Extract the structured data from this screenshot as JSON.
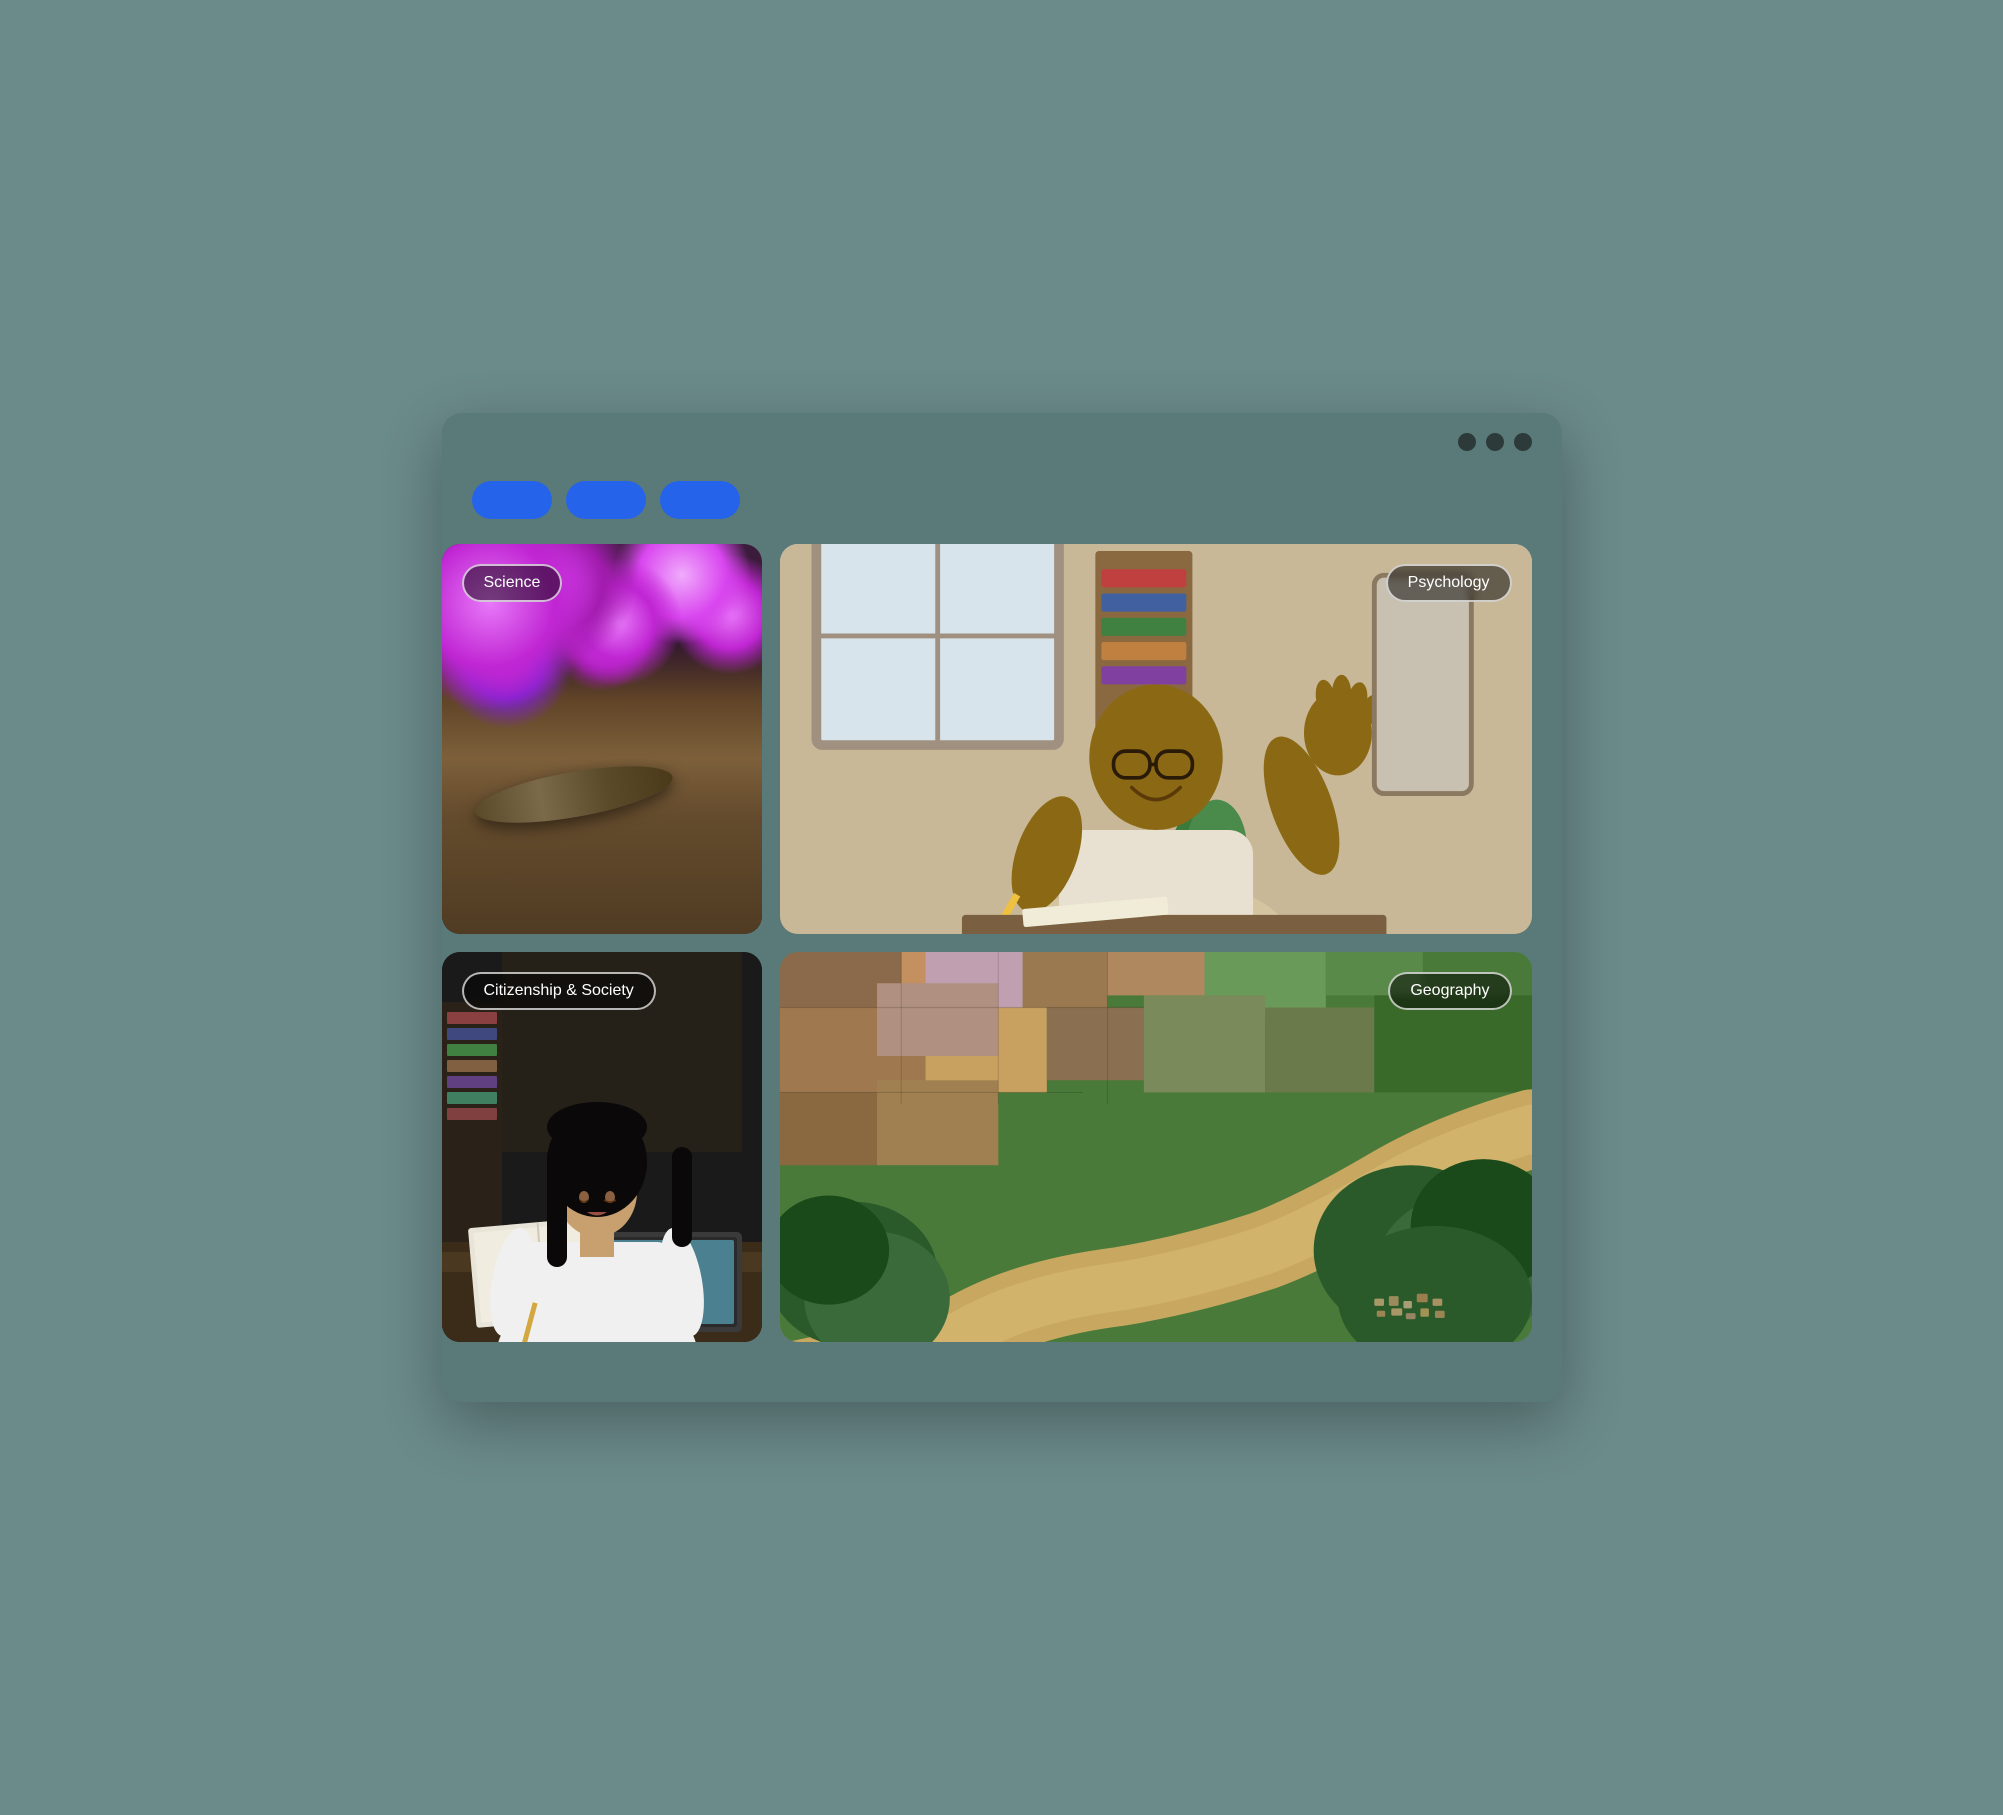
{
  "window": {
    "dots": [
      "dot1",
      "dot2",
      "dot3"
    ]
  },
  "toolbar": {
    "btn1_label": "",
    "btn2_label": "",
    "btn3_label": ""
  },
  "cards": [
    {
      "id": "science",
      "label": "Science",
      "position": "top-left",
      "label_align": "left"
    },
    {
      "id": "psychology",
      "label": "Psychology",
      "position": "top-right",
      "label_align": "right"
    },
    {
      "id": "citizenship",
      "label": "Citizenship & Society",
      "position": "bottom-left",
      "label_align": "left"
    },
    {
      "id": "geography",
      "label": "Geography",
      "position": "bottom-right",
      "label_align": "right"
    }
  ],
  "colors": {
    "browser_bg": "#527070",
    "button_blue": "#2563eb",
    "dot_dark": "#2d3a3a"
  }
}
